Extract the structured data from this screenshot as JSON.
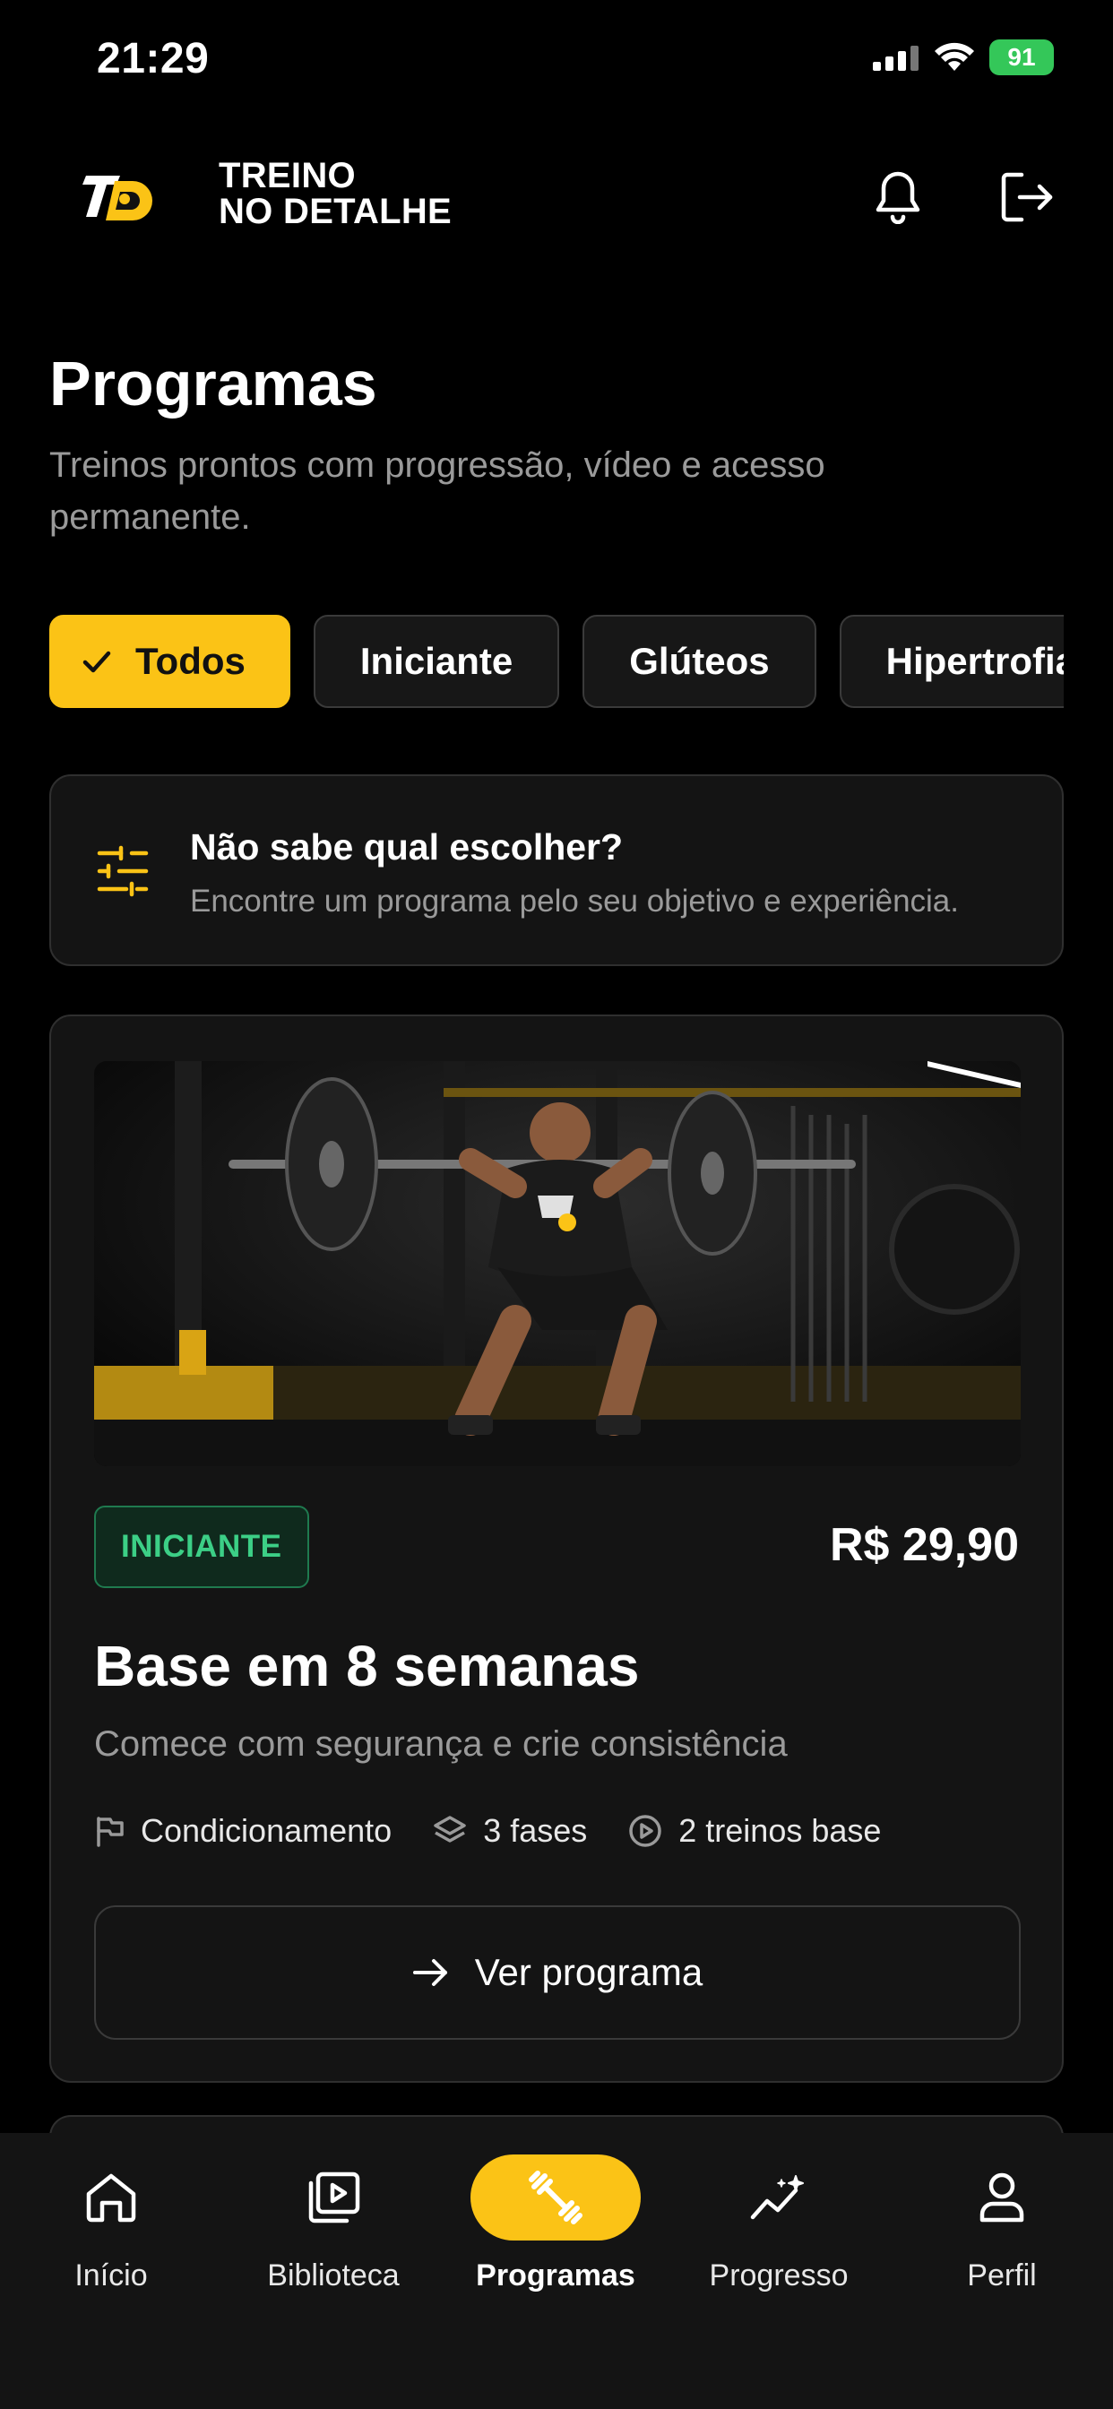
{
  "status": {
    "time": "21:29",
    "battery": "91"
  },
  "header": {
    "brand_line1": "TREINO",
    "brand_line2": "NO DETALHE",
    "logo_text": "TD"
  },
  "page": {
    "title": "Programas",
    "subtitle": "Treinos prontos com progressão, vídeo e acesso permanente."
  },
  "filters": [
    {
      "label": "Todos",
      "active": true
    },
    {
      "label": "Iniciante",
      "active": false
    },
    {
      "label": "Glúteos",
      "active": false
    },
    {
      "label": "Hipertrofia",
      "active": false
    }
  ],
  "helper": {
    "title": "Não sabe qual escolher?",
    "text": "Encontre um programa pelo seu objetivo e experiência."
  },
  "program": {
    "level": "INICIANTE",
    "price": "R$ 29,90",
    "title": "Base em 8 semanas",
    "subtitle": "Comece com segurança e crie consistência",
    "meta": {
      "goal": "Condicionamento",
      "phases": "3 fases",
      "workouts": "2 treinos base"
    },
    "cta": "Ver programa",
    "colors": {
      "badge": "#3ccf86",
      "accent": "#fbc316"
    }
  },
  "tabbar": {
    "items": [
      {
        "label": "Início",
        "icon": "home-icon"
      },
      {
        "label": "Biblioteca",
        "icon": "video-library-icon"
      },
      {
        "label": "Programas",
        "icon": "dumbbell-icon",
        "active": true
      },
      {
        "label": "Progresso",
        "icon": "progress-chart-icon"
      },
      {
        "label": "Perfil",
        "icon": "person-icon"
      }
    ]
  },
  "colors": {
    "accent": "#fbc316",
    "background": "#000000",
    "card": "#141414"
  }
}
